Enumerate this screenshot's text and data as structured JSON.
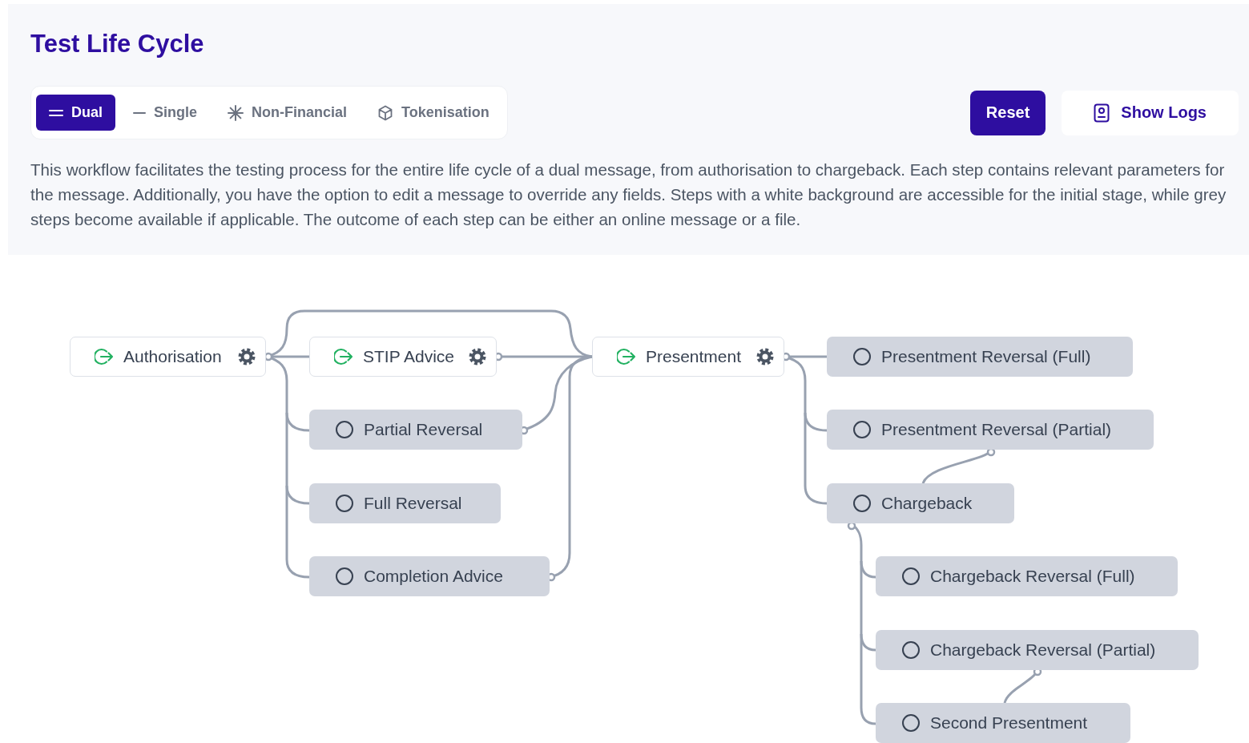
{
  "title": "Test Life Cycle",
  "modes": [
    {
      "label": "Dual",
      "selected": true
    },
    {
      "label": "Single",
      "selected": false
    },
    {
      "label": "Non-Financial",
      "selected": false
    },
    {
      "label": "Tokenisation",
      "selected": false
    }
  ],
  "buttons": [
    {
      "label": "Reset",
      "kind": "primary"
    },
    {
      "label": "Show Logs",
      "kind": "secondary"
    }
  ],
  "description": "This workflow facilitates the testing process for the entire life cycle of a dual message, from authorisation to chargeback. Each step contains relevant parameters for the message. Additionally, you have the option to edit a message to override any fields. Steps with a white background are accessible for the initial stage, while grey steps become available if applicable. The outcome of each step can be either an online message or a file.",
  "steps": [
    {
      "label": "Authorisation",
      "kind": "initial"
    },
    {
      "label": "STIP Advice",
      "kind": "initial"
    },
    {
      "label": "Partial Reversal",
      "kind": "later"
    },
    {
      "label": "Full Reversal",
      "kind": "later"
    },
    {
      "label": "Completion Advice",
      "kind": "later"
    },
    {
      "label": "Presentment",
      "kind": "initial"
    },
    {
      "label": "Presentment Reversal (Full)",
      "kind": "later"
    },
    {
      "label": "Presentment Reversal (Partial)",
      "kind": "later"
    },
    {
      "label": "Chargeback",
      "kind": "later"
    },
    {
      "label": "Chargeback Reversal (Full)",
      "kind": "later"
    },
    {
      "label": "Chargeback Reversal (Partial)",
      "kind": "later"
    },
    {
      "label": "Second Presentment",
      "kind": "later"
    }
  ]
}
